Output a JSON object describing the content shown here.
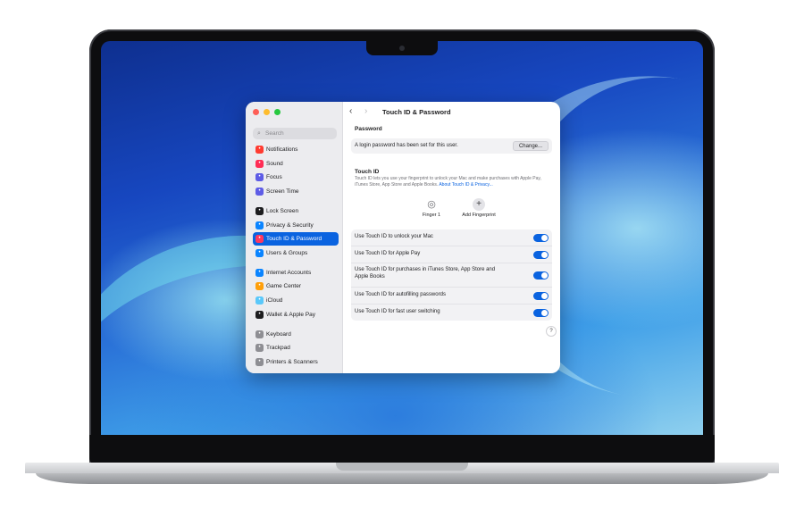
{
  "window": {
    "title": "Touch ID & Password",
    "back_glyph": "‹",
    "forward_glyph": "›"
  },
  "sidebar": {
    "search_placeholder": "Search",
    "items": [
      {
        "label": "Notifications",
        "icon": "bell-icon",
        "color": "#ff3b30"
      },
      {
        "label": "Sound",
        "icon": "speaker-icon",
        "color": "#ff2d55"
      },
      {
        "label": "Focus",
        "icon": "moon-icon",
        "color": "#5e5ce6"
      },
      {
        "label": "Screen Time",
        "icon": "hourglass-icon",
        "color": "#5e5ce6"
      },
      {
        "label": "Lock Screen",
        "icon": "lock-icon",
        "color": "#1d1d1f"
      },
      {
        "label": "Privacy & Security",
        "icon": "hand-icon",
        "color": "#0a84ff"
      },
      {
        "label": "Touch ID & Password",
        "icon": "fingerprint-icon",
        "color": "#ff375f"
      },
      {
        "label": "Users & Groups",
        "icon": "users-icon",
        "color": "#0a84ff"
      },
      {
        "label": "Internet Accounts",
        "icon": "at-icon",
        "color": "#0a84ff"
      },
      {
        "label": "Game Center",
        "icon": "game-center-icon",
        "color": "#ff9f0a"
      },
      {
        "label": "iCloud",
        "icon": "cloud-icon",
        "color": "#5ac8fa"
      },
      {
        "label": "Wallet & Apple Pay",
        "icon": "wallet-icon",
        "color": "#1d1d1f"
      },
      {
        "label": "Keyboard",
        "icon": "keyboard-icon",
        "color": "#8e8e93"
      },
      {
        "label": "Trackpad",
        "icon": "trackpad-icon",
        "color": "#8e8e93"
      },
      {
        "label": "Printers & Scanners",
        "icon": "printer-icon",
        "color": "#8e8e93"
      }
    ],
    "active_index": 6
  },
  "password": {
    "heading": "Password",
    "status": "A login password has been set for this user.",
    "change_button": "Change..."
  },
  "touch_id": {
    "heading": "Touch ID",
    "description": "Touch ID lets you use your fingerprint to unlock your Mac and make purchases with Apple Pay, iTunes Store, App Store and Apple Books.",
    "link": "About Touch ID & Privacy...",
    "fingers": [
      {
        "label": "Finger 1",
        "icon": "fingerprint-icon"
      },
      {
        "label": "Add Fingerprint",
        "icon": "plus-icon"
      }
    ]
  },
  "toggles": [
    {
      "label": "Use Touch ID to unlock your Mac",
      "on": true
    },
    {
      "label": "Use Touch ID for Apple Pay",
      "on": true
    },
    {
      "label": "Use Touch ID for purchases in iTunes Store, App Store and Apple Books",
      "on": true
    },
    {
      "label": "Use Touch ID for autofilling passwords",
      "on": true
    },
    {
      "label": "Use Touch ID for fast user switching",
      "on": true
    }
  ],
  "help_glyph": "?"
}
